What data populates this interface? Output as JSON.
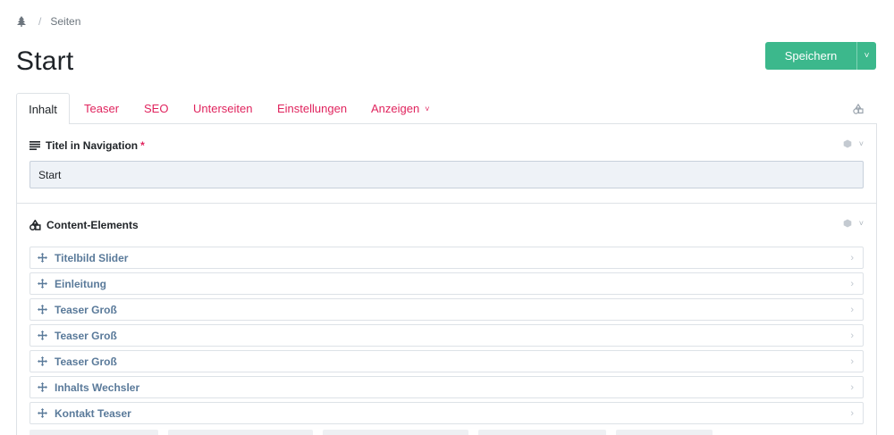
{
  "breadcrumb": {
    "separator": "/",
    "current": "Seiten"
  },
  "page": {
    "title": "Start"
  },
  "actions": {
    "save_label": "Speichern",
    "dropdown_glyph": "˅"
  },
  "tabs": [
    {
      "label": "Inhalt",
      "active": true
    },
    {
      "label": "Teaser"
    },
    {
      "label": "SEO"
    },
    {
      "label": "Unterseiten"
    },
    {
      "label": "Einstellungen"
    },
    {
      "label": "Anzeigen",
      "chevron": "˅"
    }
  ],
  "nav_field": {
    "label": "Titel in Navigation",
    "required_mark": "*",
    "value": "Start",
    "icon": "text-lines-icon"
  },
  "content_elements": {
    "label": "Content-Elements",
    "icon": "shapes-icon",
    "items": [
      {
        "label": "Titelbild Slider"
      },
      {
        "label": "Einleitung"
      },
      {
        "label": "Teaser Groß"
      },
      {
        "label": "Teaser Groß"
      },
      {
        "label": "Teaser Groß"
      },
      {
        "label": "Inhalts Wechsler"
      },
      {
        "label": "Kontakt Teaser"
      }
    ]
  },
  "glyphs": {
    "chevron_right": "›",
    "chevron_down": "˅"
  },
  "colors": {
    "accent": "#e0245e",
    "save_button": "#3cb88c",
    "input_bg": "#eef2f7",
    "item_label": "#5a7a9a"
  }
}
